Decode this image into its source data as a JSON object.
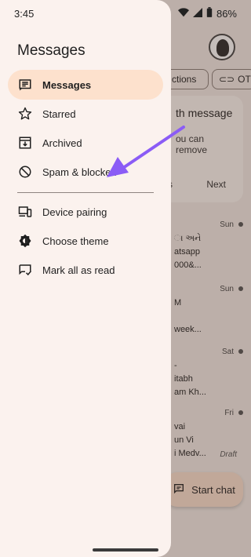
{
  "status_bar": {
    "time": "3:45",
    "battery": "86%"
  },
  "drawer": {
    "title": "Messages",
    "items": [
      {
        "label": "Messages",
        "icon": "messages-icon",
        "active": true
      },
      {
        "label": "Starred",
        "icon": "star-icon"
      },
      {
        "label": "Archived",
        "icon": "archive-icon"
      },
      {
        "label": "Spam & blocked",
        "icon": "block-icon"
      },
      {
        "label": "Device pairing",
        "icon": "device-pairing-icon"
      },
      {
        "label": "Choose theme",
        "icon": "theme-icon"
      },
      {
        "label": "Mark all as read",
        "icon": "mark-read-icon"
      }
    ]
  },
  "background": {
    "chips": [
      "ctions",
      "OTP"
    ],
    "card": {
      "title": "th message",
      "body": "ou can remove",
      "clip": "s",
      "next": "Next"
    },
    "rows": [
      {
        "day": "Sun",
        "lines": [
          "ા અને",
          "atsapp",
          "000&..."
        ]
      },
      {
        "day": "Sun",
        "lines": [
          "M",
          "",
          "week..."
        ]
      },
      {
        "day": "Sat",
        "lines": [
          "-",
          "itabh",
          "am Kh..."
        ]
      },
      {
        "day": "Fri",
        "lines": [
          "vai",
          "un Vi",
          "i Medv..."
        ]
      }
    ],
    "draft_label": "Draft",
    "fab_label": "Start chat"
  },
  "colors": {
    "accent": "#fde1cd",
    "arrow": "#8b5cf6"
  }
}
